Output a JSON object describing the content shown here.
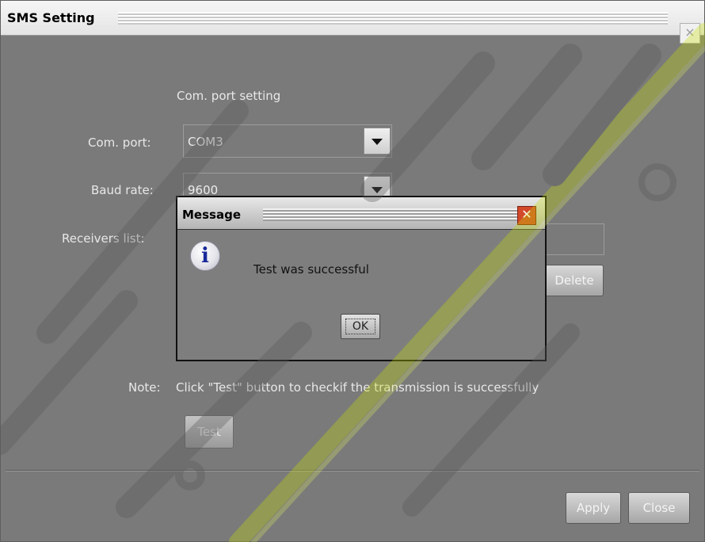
{
  "window": {
    "title": "SMS Setting",
    "close_glyph": "×"
  },
  "com_section": {
    "heading": "Com. port setting",
    "com_port_label": "Com. port:",
    "com_port_value": "COM3",
    "baud_rate_label": "Baud rate:",
    "baud_rate_value": "9600",
    "receivers_label": "Receivers list:",
    "delete_button": "Delete"
  },
  "note": {
    "label": "Note:",
    "text": "Click \"Test\" button to checkif the transmission is successfully",
    "test_button": "Test"
  },
  "footer": {
    "apply_button": "Apply",
    "close_button": "Close"
  },
  "message_dialog": {
    "title": "Message",
    "close_glyph": "✕",
    "icon": "info-icon",
    "icon_glyph": "i",
    "message": "Test was successful",
    "ok_button": "OK"
  },
  "colors": {
    "panel": "#7a7a7a",
    "dialog_close": "#d24a2a",
    "watermark_yellow": "#c8e000"
  }
}
